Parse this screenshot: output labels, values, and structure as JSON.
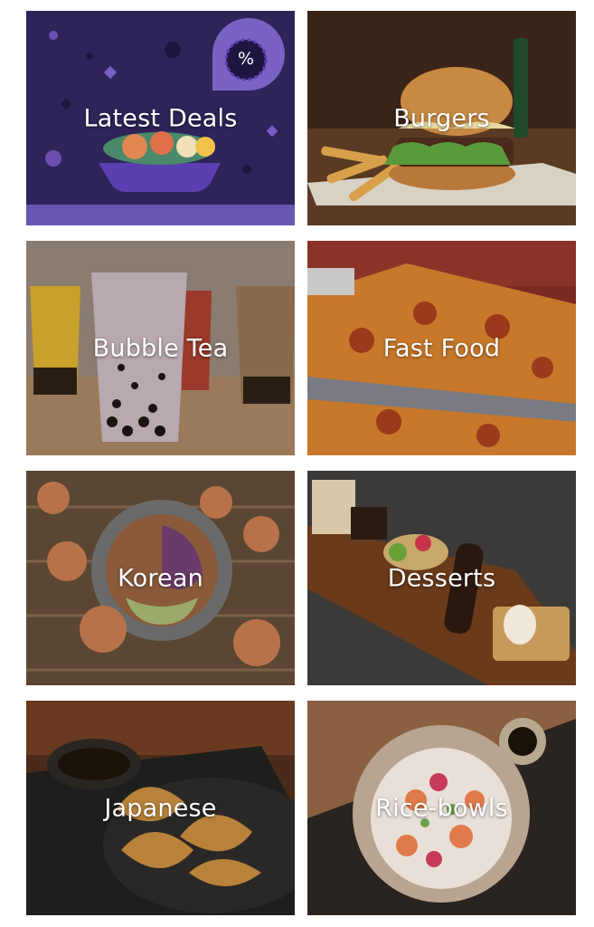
{
  "categories": [
    {
      "label": "Latest Deals",
      "image": "deals-illustration",
      "badge_icon": "percent-icon"
    },
    {
      "label": "Burgers",
      "image": "burger-photo"
    },
    {
      "label": "Bubble Tea",
      "image": "bubble-tea-photo"
    },
    {
      "label": "Fast Food",
      "image": "pizza-photo"
    },
    {
      "label": "Korean",
      "image": "korean-food-photo"
    },
    {
      "label": "Desserts",
      "image": "desserts-photo"
    },
    {
      "label": "Japanese",
      "image": "gyoza-photo"
    },
    {
      "label": "Rice-bowls",
      "image": "rice-bowl-photo"
    }
  ],
  "colors": {
    "deals_background": "#2e2459",
    "deals_accent": "#6b4fb0",
    "label_text": "#ffffff"
  }
}
